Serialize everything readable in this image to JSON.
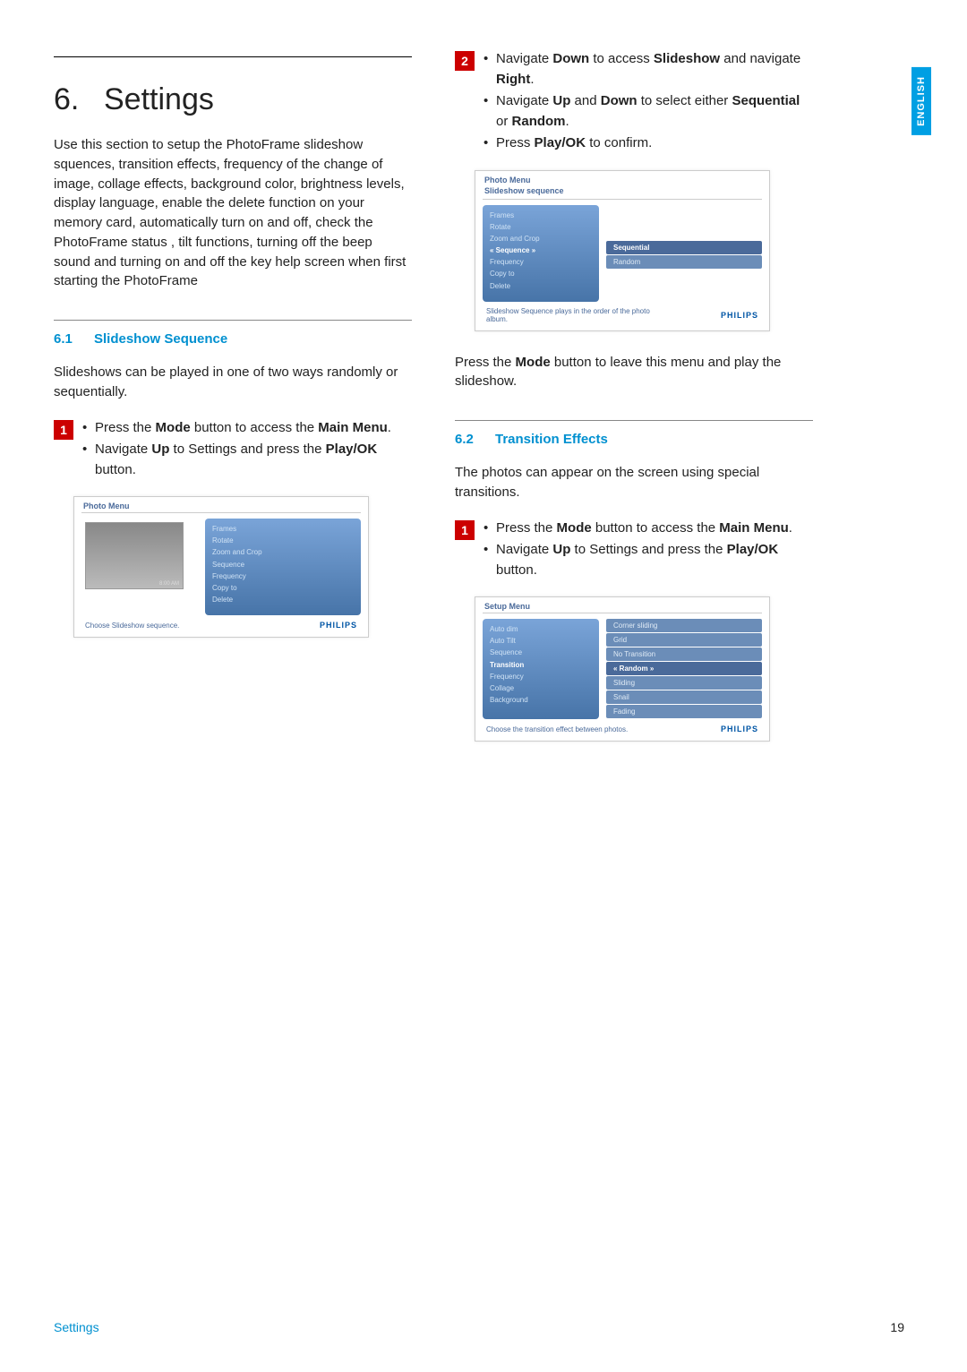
{
  "langTab": "ENGLISH",
  "chapter": {
    "num": "6.",
    "title": "Settings"
  },
  "intro": "Use this section to setup the PhotoFrame slideshow squences, transition effects, frequency of the change of image, collage effects, background color, brightness levels, display language, enable the delete function on your memory card, automatically turn on and off, check the PhotoFrame status , tilt functions, turning off the beep sound and turning on and off the key help screen when first starting the PhotoFrame",
  "s61": {
    "num": "6.1",
    "title": "Slideshow Sequence",
    "intro": "Slideshows can be played in one of two ways randomly or sequentially."
  },
  "s61_step1": {
    "badge": "1",
    "b1_a": "Press the ",
    "b1_b": "Mode",
    "b1_c": " button to access the ",
    "b1_d": "Main Menu",
    "b1_e": ".",
    "b2_a": "Navigate ",
    "b2_b": "Up",
    "b2_c": " to Settings and press the ",
    "b2_d": "Play/OK",
    "b2_e": " button."
  },
  "ss1": {
    "title": "Photo Menu",
    "thumbLabel": "8:00 AM",
    "menu": [
      "Frames",
      "Rotate",
      "Zoom and Crop",
      "Sequence",
      "Frequency",
      "Copy to",
      "Delete"
    ],
    "footer": "Choose Slideshow sequence.",
    "brand": "PHILIPS"
  },
  "s61_step2": {
    "badge": "2",
    "b1_a": "Navigate ",
    "b1_b": "Down",
    "b1_c": " to access ",
    "b1_d": "Slideshow",
    "b1_e": " and navigate ",
    "b1_f": "Right",
    "b1_g": ".",
    "b2_a": "Navigate ",
    "b2_b": "Up",
    "b2_c": " and ",
    "b2_d": "Down",
    "b2_e": " to select either ",
    "b2_f": "Sequential",
    "b2_g": " or ",
    "b2_h": "Random",
    "b2_i": ".",
    "b3_a": "Press ",
    "b3_b": "Play/OK",
    "b3_c": " to confirm."
  },
  "ss2": {
    "title": "Photo Menu",
    "subtitle": "Slideshow sequence",
    "left": [
      "Frames",
      "Rotate",
      "Zoom and Crop",
      "« Sequence »",
      "Frequency",
      "Copy to",
      "Delete"
    ],
    "leftSel": 3,
    "right": [
      "Sequential",
      "Random"
    ],
    "rightSel": 0,
    "footer": "Slideshow Sequence plays in the order of the photo album.",
    "brand": "PHILIPS"
  },
  "s61_after_a": "Press the ",
  "s61_after_b": "Mode",
  "s61_after_c": " button to leave this menu and play the slideshow.",
  "s62": {
    "num": "6.2",
    "title": "Transition Effects",
    "intro": "The photos can appear on the screen using special transitions."
  },
  "s62_step1": {
    "badge": "1",
    "b1_a": "Press the ",
    "b1_b": "Mode",
    "b1_c": " button to access the ",
    "b1_d": "Main Menu",
    "b1_e": ".",
    "b2_a": "Navigate ",
    "b2_b": "Up",
    "b2_c": " to Settings and press the ",
    "b2_d": "Play/OK",
    "b2_e": " button."
  },
  "ss3": {
    "title": "Setup Menu",
    "left": [
      "Auto dim",
      "Auto Tilt",
      "Sequence",
      "Transition",
      "Frequency",
      "Collage",
      "Background"
    ],
    "leftSel": 3,
    "right": [
      "Corner sliding",
      "Grid",
      "No Transition",
      "« Random »",
      "Sliding",
      "Snail",
      "Fading"
    ],
    "rightSel": 3,
    "footer": "Choose the transition effect between photos.",
    "brand": "PHILIPS"
  },
  "footer": {
    "label": "Settings",
    "page": "19"
  }
}
